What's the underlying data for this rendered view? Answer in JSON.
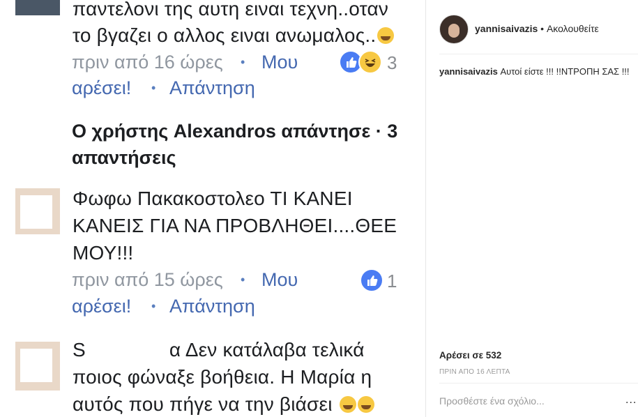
{
  "facebook": {
    "comment1": {
      "line1": "παντελονι της αυτη ειναι τεχνη..οταν",
      "line2": "το βγαζει ο αλλος ειναι ανωμαλος..",
      "time": "πριν από 16 ώρες",
      "like_part1": "Μου",
      "like_part2": "αρέσει!",
      "reply": "Απάντηση",
      "reactions_count": "3"
    },
    "replies_line1": "Ο χρήστης Alexandros απάντησε  ·  3",
    "replies_line2": "απαντήσεις",
    "comment2": {
      "line1": "Φωφω Πακακοστολεο ΤΙ ΚΑΝΕΙ",
      "line2": "ΚΑΝΕΙΣ ΓΙΑ ΝΑ ΠΡΟΒΛΗΘΕΙ....ΘΕΕ",
      "line3": "ΜΟΥ!!!",
      "time": "πριν από 15 ώρες",
      "like_part1": "Μου",
      "like_part2": "αρέσει!",
      "reply": "Απάντηση",
      "reactions_count": "1"
    },
    "comment3": {
      "name_initial": "S",
      "line1": "α Δεν κατάλαβα τελικά",
      "line2": "ποιος φώναξε βοήθεια. Η Μαρία η",
      "line3": "αυτός που πήγε να την βιάσει"
    },
    "separator_dot": "•"
  },
  "instagram": {
    "username": "yannisaivazis",
    "follow_separator": "•",
    "follow_label": "Ακολουθείτε",
    "caption_user": "yannisaivazis",
    "caption_text": "Αυτοί είστε !!! !!ΝΤΡΟΠΗ ΣΑΣ !!!",
    "likes": "Αρέσει σε 532",
    "timestamp": "ΠΡΙΝ ΑΠΟ 16 ΛΕΠΤΑ",
    "comment_placeholder": "Προσθέστε ένα σχόλιο...",
    "more_icon": "..."
  }
}
